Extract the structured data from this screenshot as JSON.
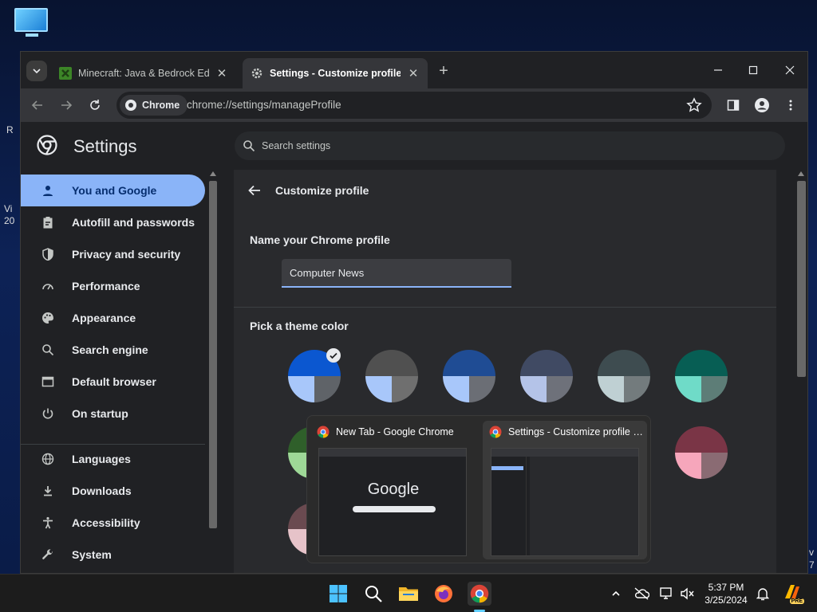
{
  "colors": {
    "accent": "#8ab4f8",
    "window_bg": "#202124",
    "content_bg": "#292a2d",
    "taskbar_bg": "#1c1c1c"
  },
  "desktop": {
    "edge_text": [
      "R",
      "Vi",
      "20",
      "v",
      "7"
    ]
  },
  "tabs": [
    {
      "label": "Minecraft: Java & Bedrock Edition",
      "icon": "minecraft-icon",
      "close": "✕"
    },
    {
      "label": "Settings - Customize profile",
      "icon": "gear-icon",
      "close": "✕"
    }
  ],
  "toolbar": {
    "chip_label": "Chrome",
    "url": "chrome://settings/manageProfile"
  },
  "settings": {
    "title": "Settings",
    "search_placeholder": "Search settings",
    "nav": [
      {
        "label": "You and Google",
        "icon": "person-icon"
      },
      {
        "label": "Autofill and passwords",
        "icon": "clipboard-icon"
      },
      {
        "label": "Privacy and security",
        "icon": "shield-icon"
      },
      {
        "label": "Performance",
        "icon": "gauge-icon"
      },
      {
        "label": "Appearance",
        "icon": "palette-icon"
      },
      {
        "label": "Search engine",
        "icon": "search-icon"
      },
      {
        "label": "Default browser",
        "icon": "browser-icon"
      },
      {
        "label": "On startup",
        "icon": "power-icon"
      },
      {
        "label": "Languages",
        "icon": "globe-icon"
      },
      {
        "label": "Downloads",
        "icon": "download-icon"
      },
      {
        "label": "Accessibility",
        "icon": "accessibility-icon"
      },
      {
        "label": "System",
        "icon": "wrench-icon"
      }
    ],
    "page_title": "Customize profile",
    "name_section_label": "Name your Chrome profile",
    "profile_name": "Computer News",
    "theme_section_label": "Pick a theme color",
    "themes": [
      {
        "top": "#0b57d0",
        "left": "#a8c7fa",
        "right": "#5f6368",
        "selected": true
      },
      {
        "top": "#505050",
        "left": "#a8c7fa",
        "right": "#6f6f6f",
        "selected": false
      },
      {
        "top": "#1f4c94",
        "left": "#a8c7fa",
        "right": "#6b6e75",
        "selected": false
      },
      {
        "top": "#404a63",
        "left": "#b4c3e8",
        "right": "#6e717a",
        "selected": false
      },
      {
        "top": "#3e4c50",
        "left": "#bfd0d3",
        "right": "#737b7d",
        "selected": false
      },
      {
        "top": "#075e54",
        "left": "#6fdbc8",
        "right": "#5d7d77",
        "selected": false
      },
      {
        "top": "#2f5f2a",
        "left": "#9ed897",
        "right": "#6a7a68",
        "selected": false
      },
      {
        "top": "#7a3546",
        "left": "#f6a6bb",
        "right": "#8a6b73",
        "selected": false
      },
      {
        "top": "#6a4a50",
        "left": "#e6c3c9",
        "right": "#7d6d70",
        "selected": false
      }
    ]
  },
  "thumbnails": [
    {
      "title": "New Tab - Google Chrome",
      "preview_logo": "Google"
    },
    {
      "title": "Settings - Customize profile - Google Chrome"
    }
  ],
  "taskbar": {
    "time": "5:37 PM",
    "date": "3/25/2024",
    "badge": "PRE"
  }
}
